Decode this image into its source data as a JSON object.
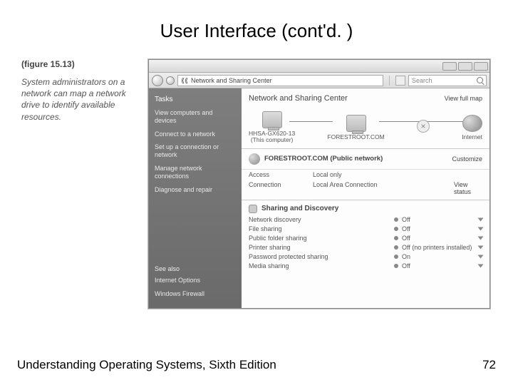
{
  "title": "User Interface (cont'd. )",
  "figure": {
    "label": "(figure 15.13)",
    "caption": "System administrators on a network can map a network drive to identify available resources."
  },
  "window": {
    "breadcrumb": "Network and Sharing Center",
    "search_placeholder": "Search",
    "tasks_title": "Tasks",
    "tasks": [
      "View computers and devices",
      "Connect to a network",
      "Set up a connection or network",
      "Manage network connections",
      "Diagnose and repair"
    ],
    "seealso_title": "See also",
    "seealso": [
      "Internet Options",
      "Windows Firewall"
    ],
    "pane_title": "Network and Sharing Center",
    "view_full_map": "View full map",
    "nodes": {
      "pc": {
        "name": "HHSA-GX620-13",
        "sub": "(This computer)"
      },
      "domain": "FORESTROOT.COM",
      "x": "×",
      "internet": "Internet"
    },
    "network": {
      "name": "FORESTROOT.COM (Public network)",
      "customize": "Customize",
      "access_label": "Access",
      "access_value": "Local only",
      "connection_label": "Connection",
      "connection_value": "Local Area Connection",
      "view_status": "View status"
    },
    "sharing": {
      "title": "Sharing and Discovery",
      "rows": [
        {
          "label": "Network discovery",
          "value": "Off"
        },
        {
          "label": "File sharing",
          "value": "Off"
        },
        {
          "label": "Public folder sharing",
          "value": "Off"
        },
        {
          "label": "Printer sharing",
          "value": "Off (no printers installed)"
        },
        {
          "label": "Password protected sharing",
          "value": "On"
        },
        {
          "label": "Media sharing",
          "value": "Off"
        }
      ]
    }
  },
  "footer": {
    "book": "Understanding Operating Systems, Sixth Edition",
    "page": "72"
  }
}
